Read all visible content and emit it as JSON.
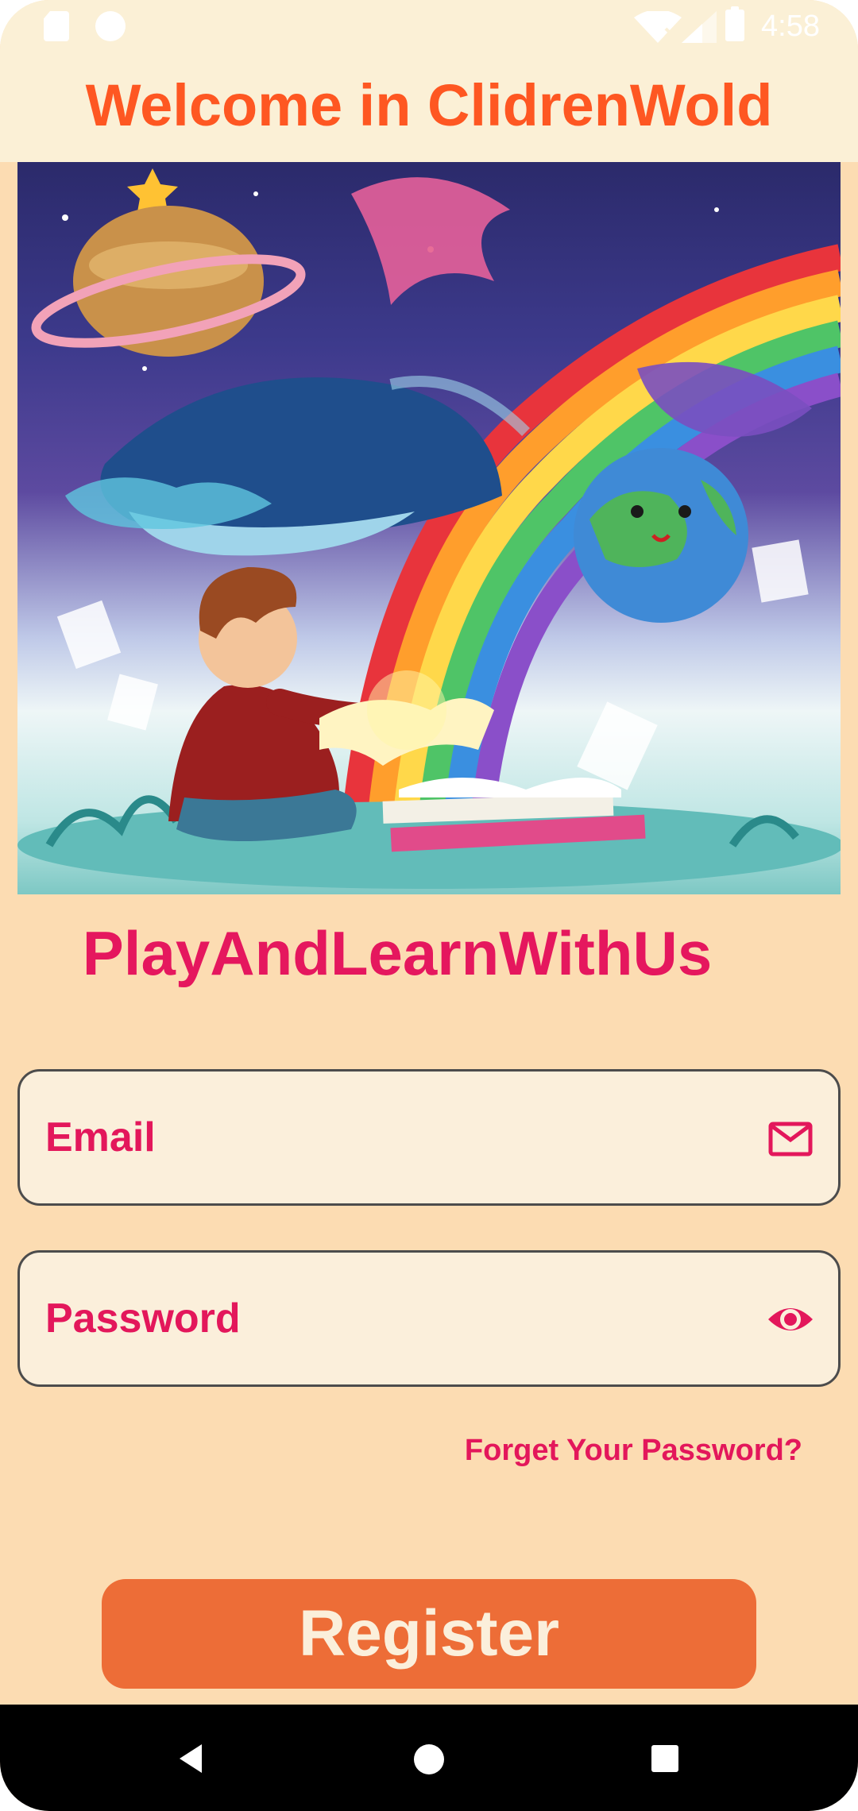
{
  "status_bar": {
    "time": "4:58",
    "icons": [
      "sd-card-icon",
      "circle-notification-icon",
      "wifi-icon",
      "signal-icon",
      "battery-icon"
    ]
  },
  "app_bar": {
    "title": "Welcome in ClidrenWold"
  },
  "hero": {
    "image": "illustration-child-reading-book-with-planets-whale-rainbow"
  },
  "tagline": "PlayAndLearnWithUs",
  "form": {
    "email": {
      "label": "Email",
      "icon": "mail-icon"
    },
    "password": {
      "label": "Password",
      "icon": "eye-icon"
    },
    "forgot_label": "Forget Your Password?",
    "register_label": "Register"
  },
  "nav_bar": {
    "icons": [
      "back-icon",
      "home-icon",
      "recents-icon"
    ]
  },
  "colors": {
    "background": "#fcdcb2",
    "app_bar": "#fbf0d6",
    "title": "#fe5722",
    "accent": "#e5175e",
    "field_bg": "#fbefdb",
    "button": "#ed6d37"
  }
}
